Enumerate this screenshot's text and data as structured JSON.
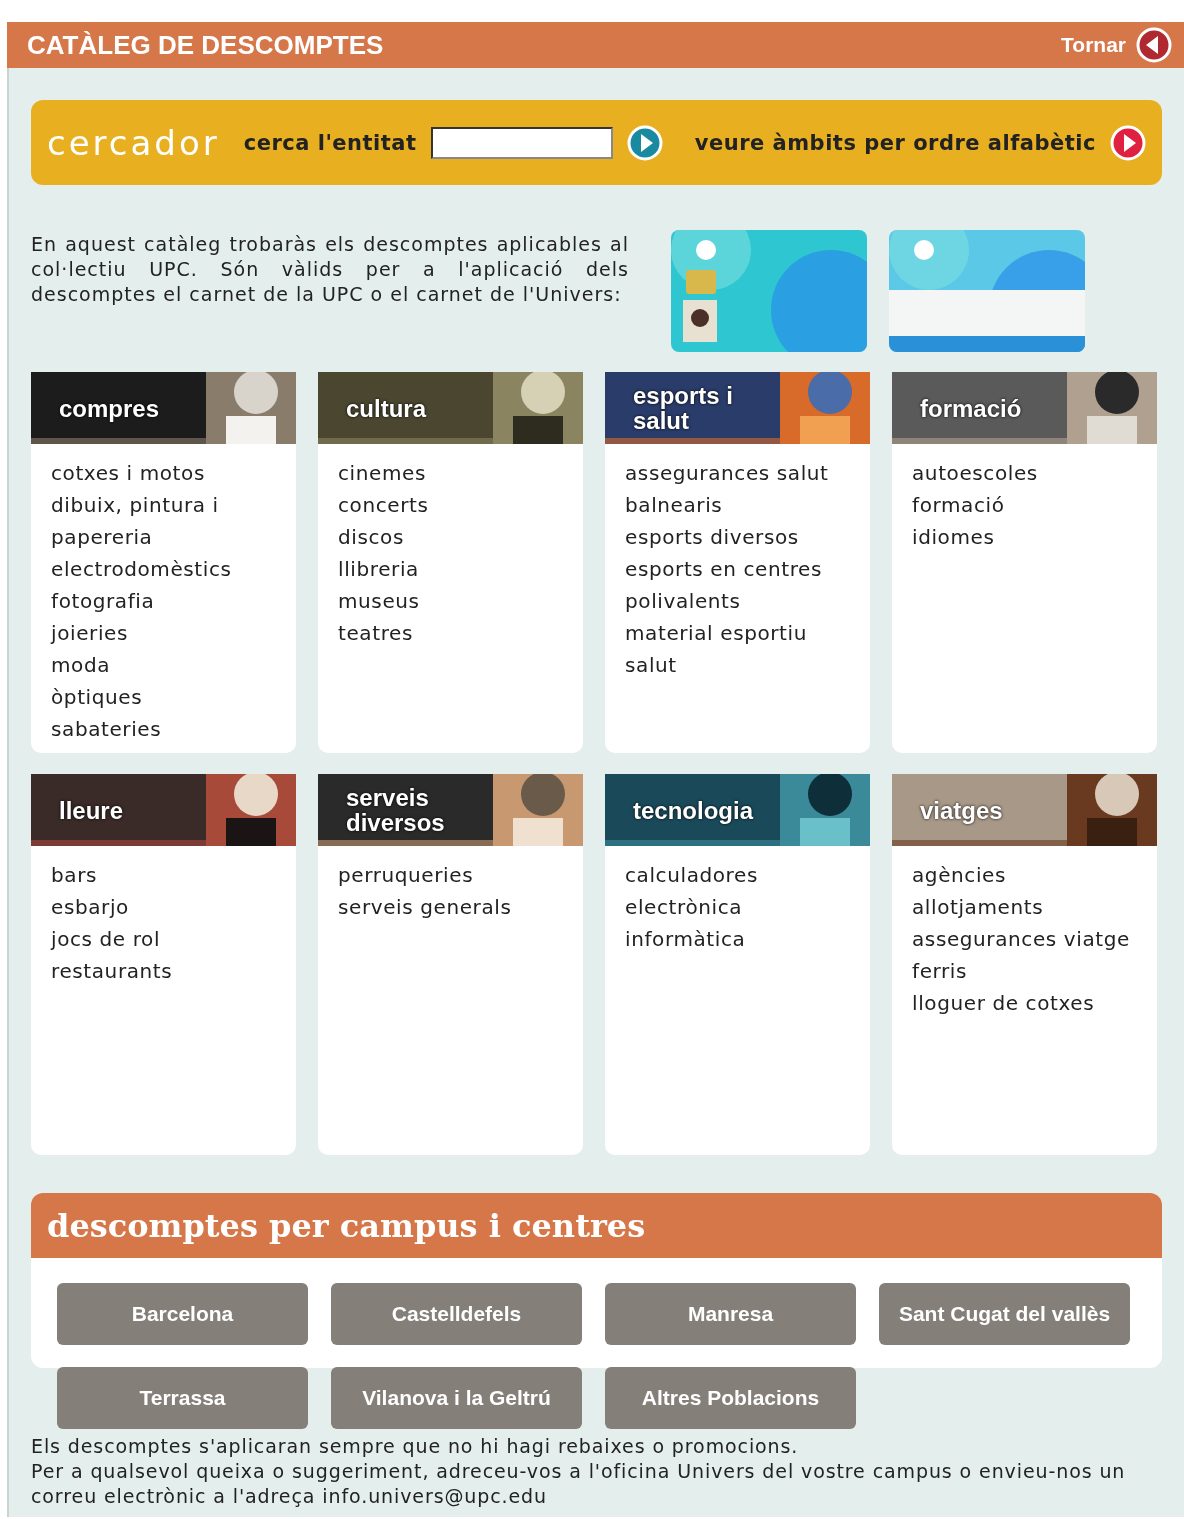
{
  "header": {
    "title": "CATÀLEG DE DESCOMPTES",
    "back_link": "Tornar"
  },
  "search": {
    "title": "cercador",
    "field_label": "cerca l'entitat",
    "alphabetic_link": "veure àmbits per ordre alfabètic"
  },
  "intro": "En aquest catàleg trobaràs els descomptes aplicables al col·lectiu UPC. Són vàlids per a l'aplicació dels descomptes el carnet de la UPC o el carnet de l'Univers:",
  "cards": [
    {
      "kind": "picture"
    },
    {
      "kind": "picture"
    }
  ],
  "categories": [
    {
      "title": "compres",
      "items": [
        "cotxes i motos",
        "dibuix, pintura i papereria",
        "electrodomèstics",
        "fotografia",
        "joieries",
        "moda",
        "òptiques",
        "sabateries"
      ]
    },
    {
      "title": "cultura",
      "items": [
        "cinemes",
        "concerts",
        "discos",
        "llibreria",
        "museus",
        "teatres"
      ]
    },
    {
      "title": "esports i salut",
      "items": [
        "assegurances salut",
        "balnearis",
        "esports diversos",
        "esports en centres polivalents",
        "material esportiu",
        "salut"
      ]
    },
    {
      "title": "formació",
      "items": [
        "autoescoles",
        "formació",
        "idiomes"
      ]
    },
    {
      "title": "lleure",
      "items": [
        "bars",
        "esbarjo",
        "jocs de rol",
        "restaurants"
      ]
    },
    {
      "title": "serveis diversos",
      "items": [
        "perruqueries",
        "serveis generals"
      ]
    },
    {
      "title": "tecnologia",
      "items": [
        "calculadores",
        "electrònica",
        "informàtica"
      ]
    },
    {
      "title": "viatges",
      "items": [
        "agències",
        "allotjaments",
        "assegurances viatge",
        "ferris",
        "lloguer de cotxes"
      ]
    }
  ],
  "campus": {
    "title": "descomptes per campus i centres",
    "buttons": [
      "Barcelona",
      "Castelldefels",
      "Manresa",
      "Sant Cugat del vallès",
      "Terrassa",
      "Vilanova i la Geltrú",
      "Altres Poblacions"
    ]
  },
  "footer": [
    "Els descomptes s'aplicaran sempre que no hi hagi rebaixes o promocions.",
    "Per a qualsevol queixa o suggeriment, adreceu-vos a l'oficina Univers del vostre campus o envieu-nos un correu electrònic a l'adreça info.univers@upc.edu"
  ]
}
